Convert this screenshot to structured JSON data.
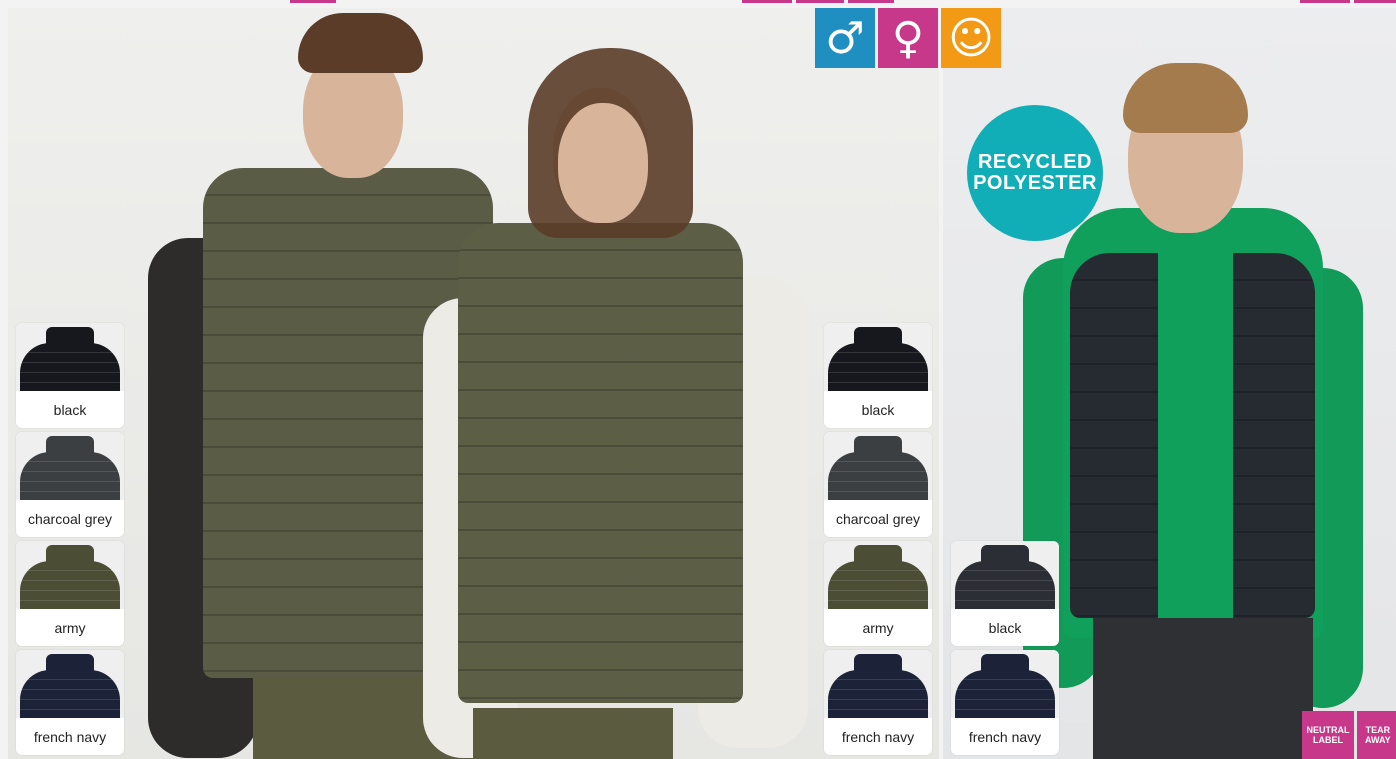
{
  "gender_icons": [
    {
      "name": "male",
      "glyph": "♂",
      "color": "#1f8fc2"
    },
    {
      "name": "female",
      "glyph": "♀",
      "color": "#c7388a"
    },
    {
      "name": "kids",
      "glyph": "☺",
      "color": "#f29a15"
    }
  ],
  "badge": {
    "line1": "RECYCLED",
    "line2": "POLYESTER",
    "color": "#12aeb7"
  },
  "adult_left_swatches": [
    {
      "label": "black",
      "color": "#16181d"
    },
    {
      "label": "charcoal grey",
      "color": "#3c3f42"
    },
    {
      "label": "army",
      "color": "#4c4d35"
    },
    {
      "label": "french navy",
      "color": "#1c2237"
    }
  ],
  "adult_right_swatches": [
    {
      "label": "black",
      "color": "#16181d"
    },
    {
      "label": "charcoal grey",
      "color": "#3c3f42"
    },
    {
      "label": "army",
      "color": "#4c4d35"
    },
    {
      "label": "french navy",
      "color": "#1c2237"
    }
  ],
  "kids_swatches": [
    {
      "label": "black",
      "color": "#2b2e34"
    },
    {
      "label": "french navy",
      "color": "#1c2237"
    }
  ],
  "tags": [
    {
      "line1": "NEUTRAL",
      "line2": "LABEL"
    },
    {
      "line1": "TEAR",
      "line2": "AWAY"
    }
  ]
}
